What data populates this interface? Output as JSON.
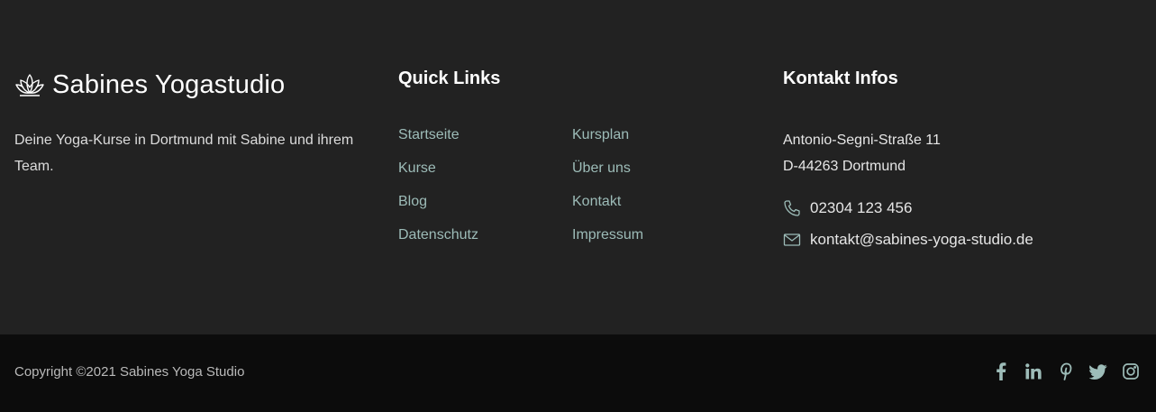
{
  "brand": {
    "name": "Sabines Yogastudio",
    "description": "Deine Yoga-Kurse in Dortmund mit Sabine und ihrem Team.",
    "icon": "lotus-icon"
  },
  "quick_links": {
    "title": "Quick Links",
    "items": [
      {
        "label": "Startseite"
      },
      {
        "label": "Kursplan"
      },
      {
        "label": "Kurse"
      },
      {
        "label": "Über uns"
      },
      {
        "label": "Blog"
      },
      {
        "label": "Kontakt"
      },
      {
        "label": "Datenschutz"
      },
      {
        "label": "Impressum"
      }
    ]
  },
  "contact": {
    "title": "Kontakt Infos",
    "address_line1": "Antonio-Segni-Straße 11",
    "address_line2": "D-44263 Dortmund",
    "phone": "02304 123 456",
    "email": "kontakt@sabines-yoga-studio.de"
  },
  "bottom": {
    "copyright": "Copyright ©2021 Sabines Yoga Studio",
    "socials": [
      "facebook-icon",
      "linkedin-icon",
      "pinterest-icon",
      "twitter-icon",
      "instagram-icon"
    ]
  },
  "colors": {
    "background": "#222222",
    "bottom_background": "#0c0c0c",
    "link": "#9dbcb8",
    "social": "#9dbcb8"
  }
}
